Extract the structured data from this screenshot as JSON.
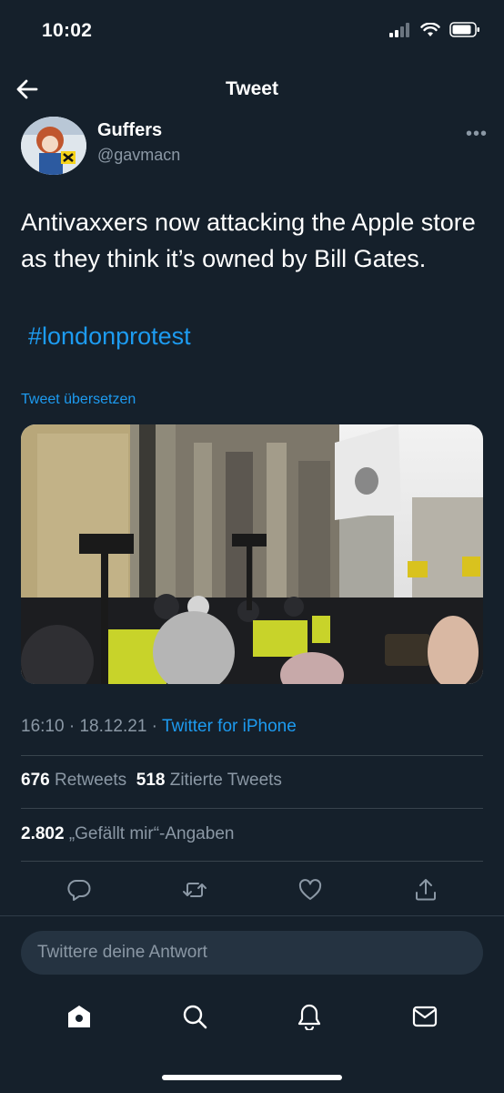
{
  "status": {
    "time": "10:02"
  },
  "header": {
    "title": "Tweet"
  },
  "author": {
    "name": "Guffers",
    "handle": "@gavmacn"
  },
  "tweet": {
    "text": "Antivaxxers now attacking the Apple store as they think it’s owned by Bill Gates.",
    "hashtag": "#londonprotest",
    "translate_label": "Tweet übersetzen"
  },
  "meta": {
    "time": "16:10",
    "date": "18.12.21",
    "source": "Twitter for iPhone"
  },
  "stats": {
    "retweets": "676",
    "retweets_label": "Retweets",
    "quotes": "518",
    "quotes_label": "Zitierte Tweets",
    "likes": "2.802",
    "likes_label": "„Gefällt mir“-Angaben"
  },
  "actions": [
    "reply-icon",
    "retweet-icon",
    "like-icon",
    "share-icon"
  ],
  "reply": {
    "placeholder": "Twittere deine Antwort"
  },
  "tabbar": [
    "home-icon",
    "search-icon",
    "notifications-icon",
    "messages-icon"
  ],
  "colors": {
    "background": "#15202b",
    "accent": "#1d9bf0",
    "muted": "#8b98a5",
    "divider": "#38444d"
  }
}
